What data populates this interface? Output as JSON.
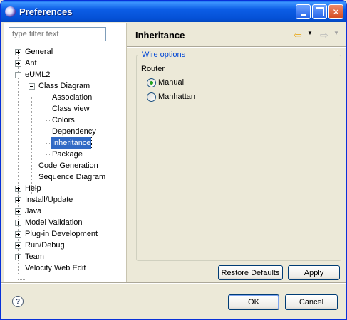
{
  "window": {
    "title": "Preferences"
  },
  "filter": {
    "placeholder": "type filter text",
    "value": ""
  },
  "tree": {
    "general": "General",
    "ant": "Ant",
    "euml2": "eUML2",
    "class_diagram": "Class Diagram",
    "association": "Association",
    "class_view": "Class view",
    "colors": "Colors",
    "dependency": "Dependency",
    "inheritance": "Inheritance",
    "package": "Package",
    "code_generation": "Code Generation",
    "sequence_diagram": "Sequence Diagram",
    "help": "Help",
    "install_update": "Install/Update",
    "java": "Java",
    "model_validation": "Model Validation",
    "plugin_development": "Plug-in Development",
    "run_debug": "Run/Debug",
    "team": "Team",
    "velocity_web_edit": "Velocity Web Edit"
  },
  "page": {
    "title": "Inheritance",
    "group_label": "Wire options",
    "router_label": "Router",
    "options": {
      "manual": "Manual",
      "manhattan": "Manhattan"
    },
    "selected_option": "Manual"
  },
  "buttons": {
    "restore_defaults": "Restore Defaults",
    "apply": "Apply",
    "ok": "OK",
    "cancel": "Cancel",
    "help": "?"
  },
  "icons": {
    "app": "eclipse-icon",
    "back": "back-arrow-icon",
    "forward": "forward-arrow-icon",
    "help": "help-icon"
  },
  "colors": {
    "titlebar": "#0450d5",
    "selection": "#316ac5",
    "group_label": "#0046d5",
    "radio_checked": "#21a121"
  }
}
